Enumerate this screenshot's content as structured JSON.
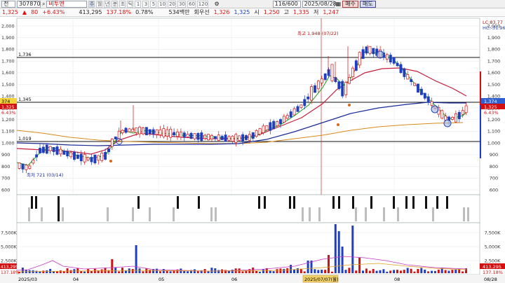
{
  "toolbar": {
    "market_select": "전",
    "stock_code": "307870",
    "stock_name": "비투엔",
    "periods": [
      "주",
      "월",
      "년",
      "분",
      "초",
      "틱"
    ],
    "active_period": "주",
    "intervals": [
      "1",
      "3",
      "5",
      "10",
      "20",
      "30",
      "60",
      "120"
    ],
    "count": "116/600",
    "date": "2025/08/28",
    "buy_label": "매수",
    "sell_label": "매도"
  },
  "quote": {
    "price": "1,325",
    "arrow": "▲",
    "change": "80",
    "change_pct": "+6.43%",
    "volume": "413,295",
    "vol_ratio": "137.18%",
    "turnover": "0.78%",
    "amount_text": "534백만",
    "exchange_label": "회우선",
    "ask": "1,326",
    "bid": "1,325",
    "open_label": "시",
    "open": "1,250",
    "high_label": "고",
    "high": "1,335",
    "low_label": "저",
    "low": "1,247"
  },
  "price_axis": {
    "labels": [
      "2,000",
      "1,900",
      "1,800",
      "1,700",
      "1,600",
      "1,500",
      "1,400",
      "1,300",
      "1,200",
      "1,100",
      "1,000",
      "900",
      "800",
      "700",
      "600"
    ],
    "top_right_1": "LC:83.77",
    "top_right_2": "HC:-31.96",
    "tags": [
      "1,374",
      "1,325",
      "6.43%"
    ]
  },
  "left_tags": [
    "374",
    "1,325",
    "6.43%"
  ],
  "annotations": {
    "hline_1736": "1,736",
    "hline_1345": "1,345",
    "hline_1019": "1,019",
    "high_marker": "최고 1,948 (07/22)",
    "low_marker": "최저 721 (03/14)"
  },
  "volume_axis": {
    "labels": [
      "7,500K",
      "5,000K",
      "2,500K"
    ],
    "tags": [
      "413,295",
      "137.18%"
    ]
  },
  "left_vol_tags": [
    "413,295",
    "137.18%"
  ],
  "date_axis": {
    "labels": [
      "2025/03",
      "04",
      "05",
      "06",
      "07",
      "08",
      "08/28"
    ],
    "crosshair": "2025/07/07(월)"
  },
  "colors": {
    "up": "#d11111",
    "down": "#1f3fbf",
    "ma5": "#1a9a1a",
    "ma20": "#c41f3c",
    "ma60": "#1a2a9a",
    "ma120": "#d28a1a"
  }
}
